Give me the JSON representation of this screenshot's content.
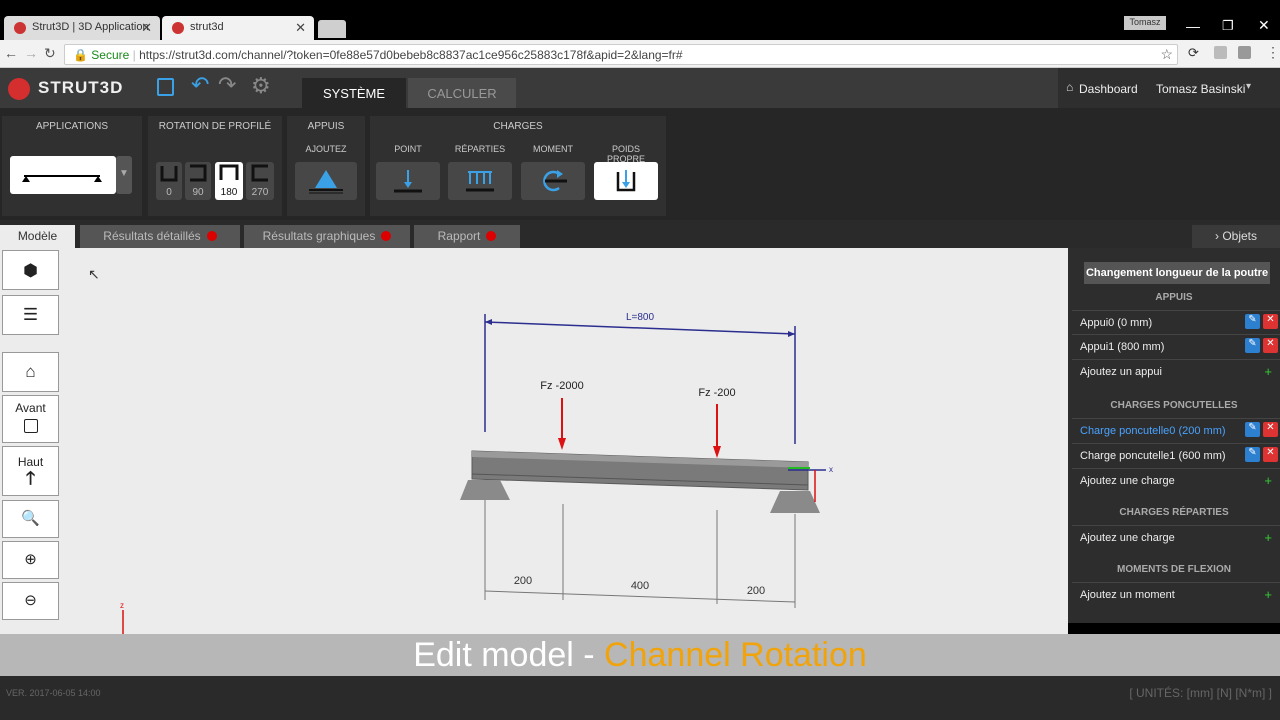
{
  "browser": {
    "tabs": [
      {
        "label": "Strut3D | 3D Application"
      },
      {
        "label": "strut3d"
      }
    ],
    "user_badge": "Tomasz",
    "secure_label": "Secure",
    "url": "https://strut3d.com/channel/?token=0fe88e57d0bebeb8c8837ac1ce956c25883c178f&apid=2&lang=fr#"
  },
  "app": {
    "logo": "STRUT3D",
    "tabs": {
      "system": "SYSTÈME",
      "compute": "CALCULER"
    },
    "dashboard": "Dashboard",
    "user": "Tomasz Basinski"
  },
  "toolbar": {
    "applications": "APPLICATIONS",
    "rotation": {
      "label": "ROTATION DE PROFILÉ",
      "options": [
        "0",
        "90",
        "180",
        "270"
      ],
      "selected": "180"
    },
    "supports": {
      "label": "APPUIS",
      "add": "AJOUTEZ"
    },
    "loads": {
      "label": "CHARGES",
      "point": "POINT",
      "distributed": "RÉPARTIES",
      "moment": "MOMENT",
      "self_weight": "POIDS PROPRE"
    }
  },
  "view_tabs": {
    "model": "Modèle",
    "detailed": "Résultats détaillés",
    "graphic": "Résultats graphiques",
    "report": "Rapport",
    "objects": "Objets"
  },
  "side": {
    "front": "Avant",
    "top": "Haut"
  },
  "scene": {
    "length_label": "L=800",
    "load1": "Fz -2000",
    "load2": "Fz -200",
    "dims": [
      "200",
      "400",
      "200"
    ],
    "axis_z": "z",
    "axis_y": "y",
    "axis_x": "x"
  },
  "panel": {
    "length_button": "Changement longueur de la poutre",
    "supports_header": "APPUIS",
    "supports": [
      "Appui0 (0 mm)",
      "Appui1 (800 mm)"
    ],
    "add_support": "Ajoutez un appui",
    "point_header": "CHARGES PONCUTELLES",
    "point_loads": [
      "Charge poncutelle0 (200 mm)",
      "Charge poncutelle1 (600 mm)"
    ],
    "add_load": "Ajoutez une charge",
    "dist_header": "CHARGES RÉPARTIES",
    "add_dist": "Ajoutez une charge",
    "moments_header": "MOMENTS DE FLEXION",
    "add_moment": "Ajoutez un moment"
  },
  "caption": {
    "part1": "Edit model - ",
    "part2": "Channel Rotation"
  },
  "footer": {
    "version": "VER. 2017-06-05 14:00",
    "units": "[ UNITÉS: [mm] [N] [N*m] ]"
  },
  "colors": {
    "accent": "#f0a30a",
    "link_blue": "#4aa3ff"
  }
}
